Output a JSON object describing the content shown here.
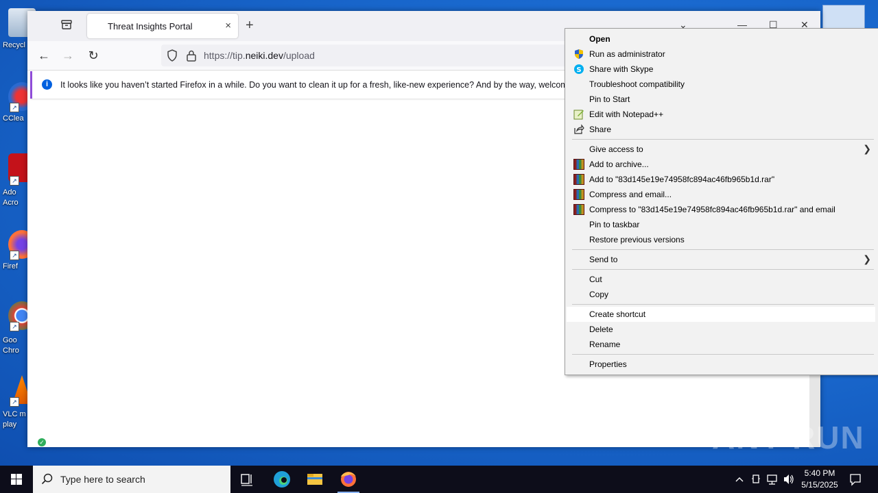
{
  "desktop": {
    "icons": [
      {
        "label": "Recycl"
      },
      {
        "label": "CClea"
      },
      {
        "label": "Ado\nAcro"
      },
      {
        "label": "Firef"
      },
      {
        "label": "Goo\nChro"
      },
      {
        "label": "VLC m\nplay"
      }
    ]
  },
  "browser": {
    "tab_title": "Threat Insights Portal",
    "tab_close": "×",
    "new_tab": "+",
    "url_host_prefix": "https://tip.",
    "url_host": "neiki.dev",
    "url_path": "/upload",
    "notice": "It looks like you haven’t started Firefox in a while. Do you want to clean it up for a fresh, like-new experience? And by the way, welcome back!"
  },
  "context_menu": {
    "items": [
      {
        "label": "Open",
        "bold": true
      },
      {
        "label": "Run as administrator",
        "icon": "shield-icon"
      },
      {
        "label": "Share with Skype",
        "icon": "skype-icon"
      },
      {
        "label": "Troubleshoot compatibility"
      },
      {
        "label": "Pin to Start"
      },
      {
        "label": "Edit with Notepad++",
        "icon": "notepad-plus-plus-icon"
      },
      {
        "label": "Share",
        "icon": "share-icon"
      },
      {
        "label": "Give access to",
        "submenu": true
      },
      {
        "label": "Add to archive...",
        "icon": "winrar-icon"
      },
      {
        "label": "Add to \"83d145e19e74958fc894ac46fb965b1d.rar\"",
        "icon": "winrar-icon"
      },
      {
        "label": "Compress and email...",
        "icon": "winrar-icon"
      },
      {
        "label": "Compress to \"83d145e19e74958fc894ac46fb965b1d.rar\" and email",
        "icon": "winrar-icon"
      },
      {
        "label": "Pin to taskbar"
      },
      {
        "label": "Restore previous versions"
      },
      {
        "label": "Send to",
        "submenu": true
      },
      {
        "label": "Cut"
      },
      {
        "label": "Copy"
      },
      {
        "label": "Create shortcut",
        "highlighted": true
      },
      {
        "label": "Delete"
      },
      {
        "label": "Rename"
      },
      {
        "label": "Properties"
      }
    ]
  },
  "taskbar": {
    "search_placeholder": "Type here to search",
    "time": "5:40 PM",
    "date": "5/15/2025"
  },
  "watermark": "ANY RUN"
}
